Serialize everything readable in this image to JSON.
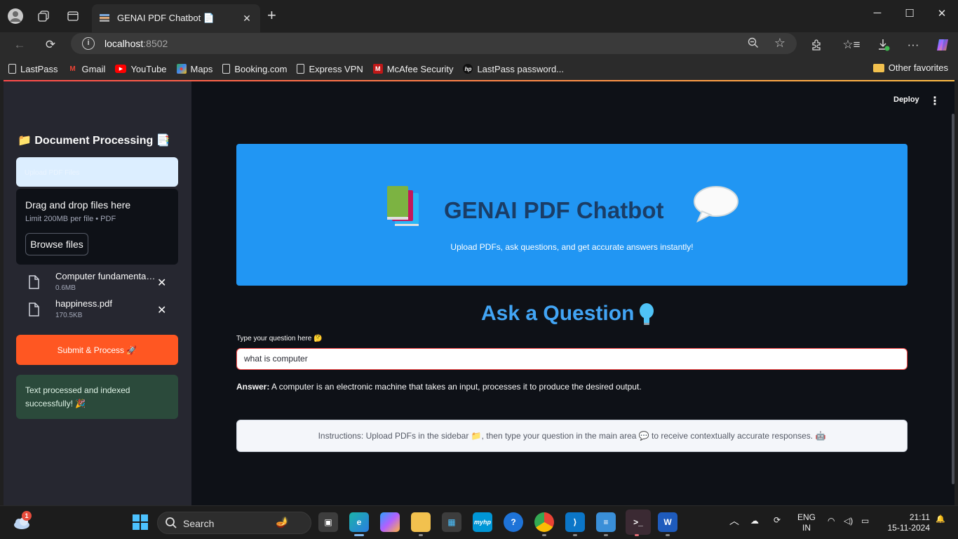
{
  "browser": {
    "tab_title": "GENAI PDF Chatbot 📄",
    "url_host": "localhost",
    "url_port": ":8502",
    "bookmarks": [
      {
        "label": "LastPass",
        "icon": "lastpass-icon"
      },
      {
        "label": "Gmail",
        "icon": "gmail-icon"
      },
      {
        "label": "YouTube",
        "icon": "youtube-icon"
      },
      {
        "label": "Maps",
        "icon": "maps-icon"
      },
      {
        "label": "Booking.com",
        "icon": "page-icon"
      },
      {
        "label": "Express VPN",
        "icon": "page-icon"
      },
      {
        "label": "McAfee Security",
        "icon": "mcafee-icon"
      },
      {
        "label": "LastPass password...",
        "icon": "hp-icon"
      }
    ],
    "other_favorites": "Other favorites"
  },
  "app": {
    "deploy_label": "Deploy",
    "sidebar": {
      "title": "📁 Document Processing 📑",
      "upload_label": "Upload PDF Files",
      "dropzone_title": "Drag and drop files here",
      "dropzone_limit": "Limit 200MB per file • PDF",
      "browse_label": "Browse files",
      "files": [
        {
          "name": "Computer fundamentals.pdf",
          "size": "0.6MB"
        },
        {
          "name": "happiness.pdf",
          "size": "170.5KB"
        }
      ],
      "submit_label": "Submit & Process 🚀",
      "success_message": "Text processed and indexed successfully! 🎉"
    },
    "hero": {
      "title": "GENAI PDF Chatbot",
      "subtitle": "Upload PDFs, ask questions, and get accurate answers instantly!"
    },
    "ask_title": "Ask a Question",
    "question_label": "Type your question here 🤔",
    "question_value": "what is computer",
    "answer_prefix": "Answer:",
    "answer_text": " A computer is an electronic machine that takes an input, processes it to produce the desired output.",
    "instructions": "Instructions: Upload PDFs in the sidebar 📁, then type your question in the main area 💬 to receive contextually accurate responses. 🤖"
  },
  "taskbar": {
    "search_placeholder": "Search",
    "weather_badge": "1",
    "language": "ENG",
    "region": "IN",
    "time": "21:11",
    "date": "15-11-2024"
  },
  "colors": {
    "hero_bg": "#2196f3",
    "submit_bg": "#ff5722",
    "success_bg": "#2b4a3b",
    "ask_title": "#42a5f5"
  }
}
